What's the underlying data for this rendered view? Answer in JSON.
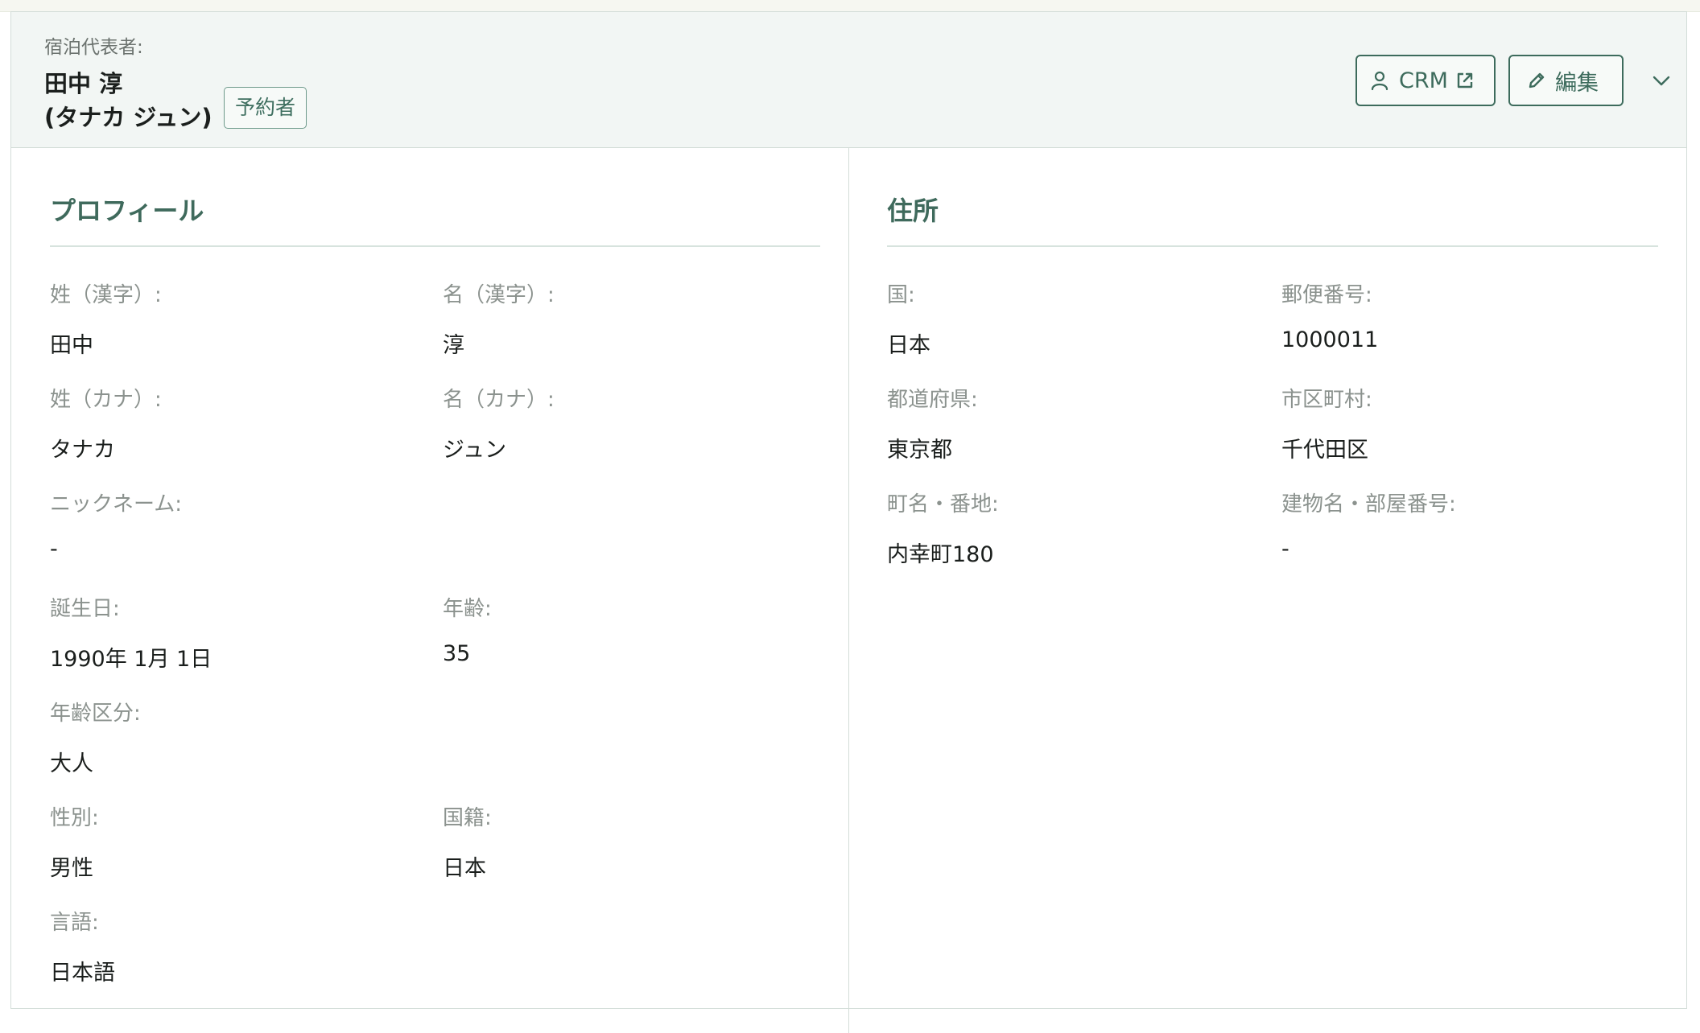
{
  "header": {
    "caption": "宿泊代表者:",
    "name": "田中 淳",
    "kana": "(タナカ ジュン)",
    "badge": "予約者",
    "crm_label": "CRM",
    "edit_label": "編集"
  },
  "profile": {
    "title": "プロフィール",
    "last_name_kanji_label": "姓（漢字）:",
    "last_name_kanji": "田中",
    "first_name_kanji_label": "名（漢字）:",
    "first_name_kanji": "淳",
    "last_name_kana_label": "姓（カナ）:",
    "last_name_kana": "タナカ",
    "first_name_kana_label": "名（カナ）:",
    "first_name_kana": "ジュン",
    "nickname_label": "ニックネーム:",
    "nickname": "-",
    "birthday_label": "誕生日:",
    "birthday": "1990年 1月 1日",
    "age_label": "年齢:",
    "age": "35",
    "age_group_label": "年齢区分:",
    "age_group": "大人",
    "gender_label": "性別:",
    "gender": "男性",
    "nationality_label": "国籍:",
    "nationality": "日本",
    "language_label": "言語:",
    "language": "日本語"
  },
  "address": {
    "title": "住所",
    "country_label": "国:",
    "country": "日本",
    "postal_label": "郵便番号:",
    "postal": "1000011",
    "prefecture_label": "都道府県:",
    "prefecture": "東京都",
    "city_label": "市区町村:",
    "city": "千代田区",
    "street_label": "町名・番地:",
    "street": "内幸町180",
    "building_label": "建物名・部屋番号:",
    "building": "-"
  },
  "colors": {
    "accent": "#3d6b5c",
    "header_bg": "#f2f6f4",
    "label": "#8b928e"
  },
  "icons": {
    "crm_person": "person-icon",
    "crm_external": "external-link-icon",
    "edit": "pencil-icon",
    "expand": "chevron-down-icon"
  }
}
